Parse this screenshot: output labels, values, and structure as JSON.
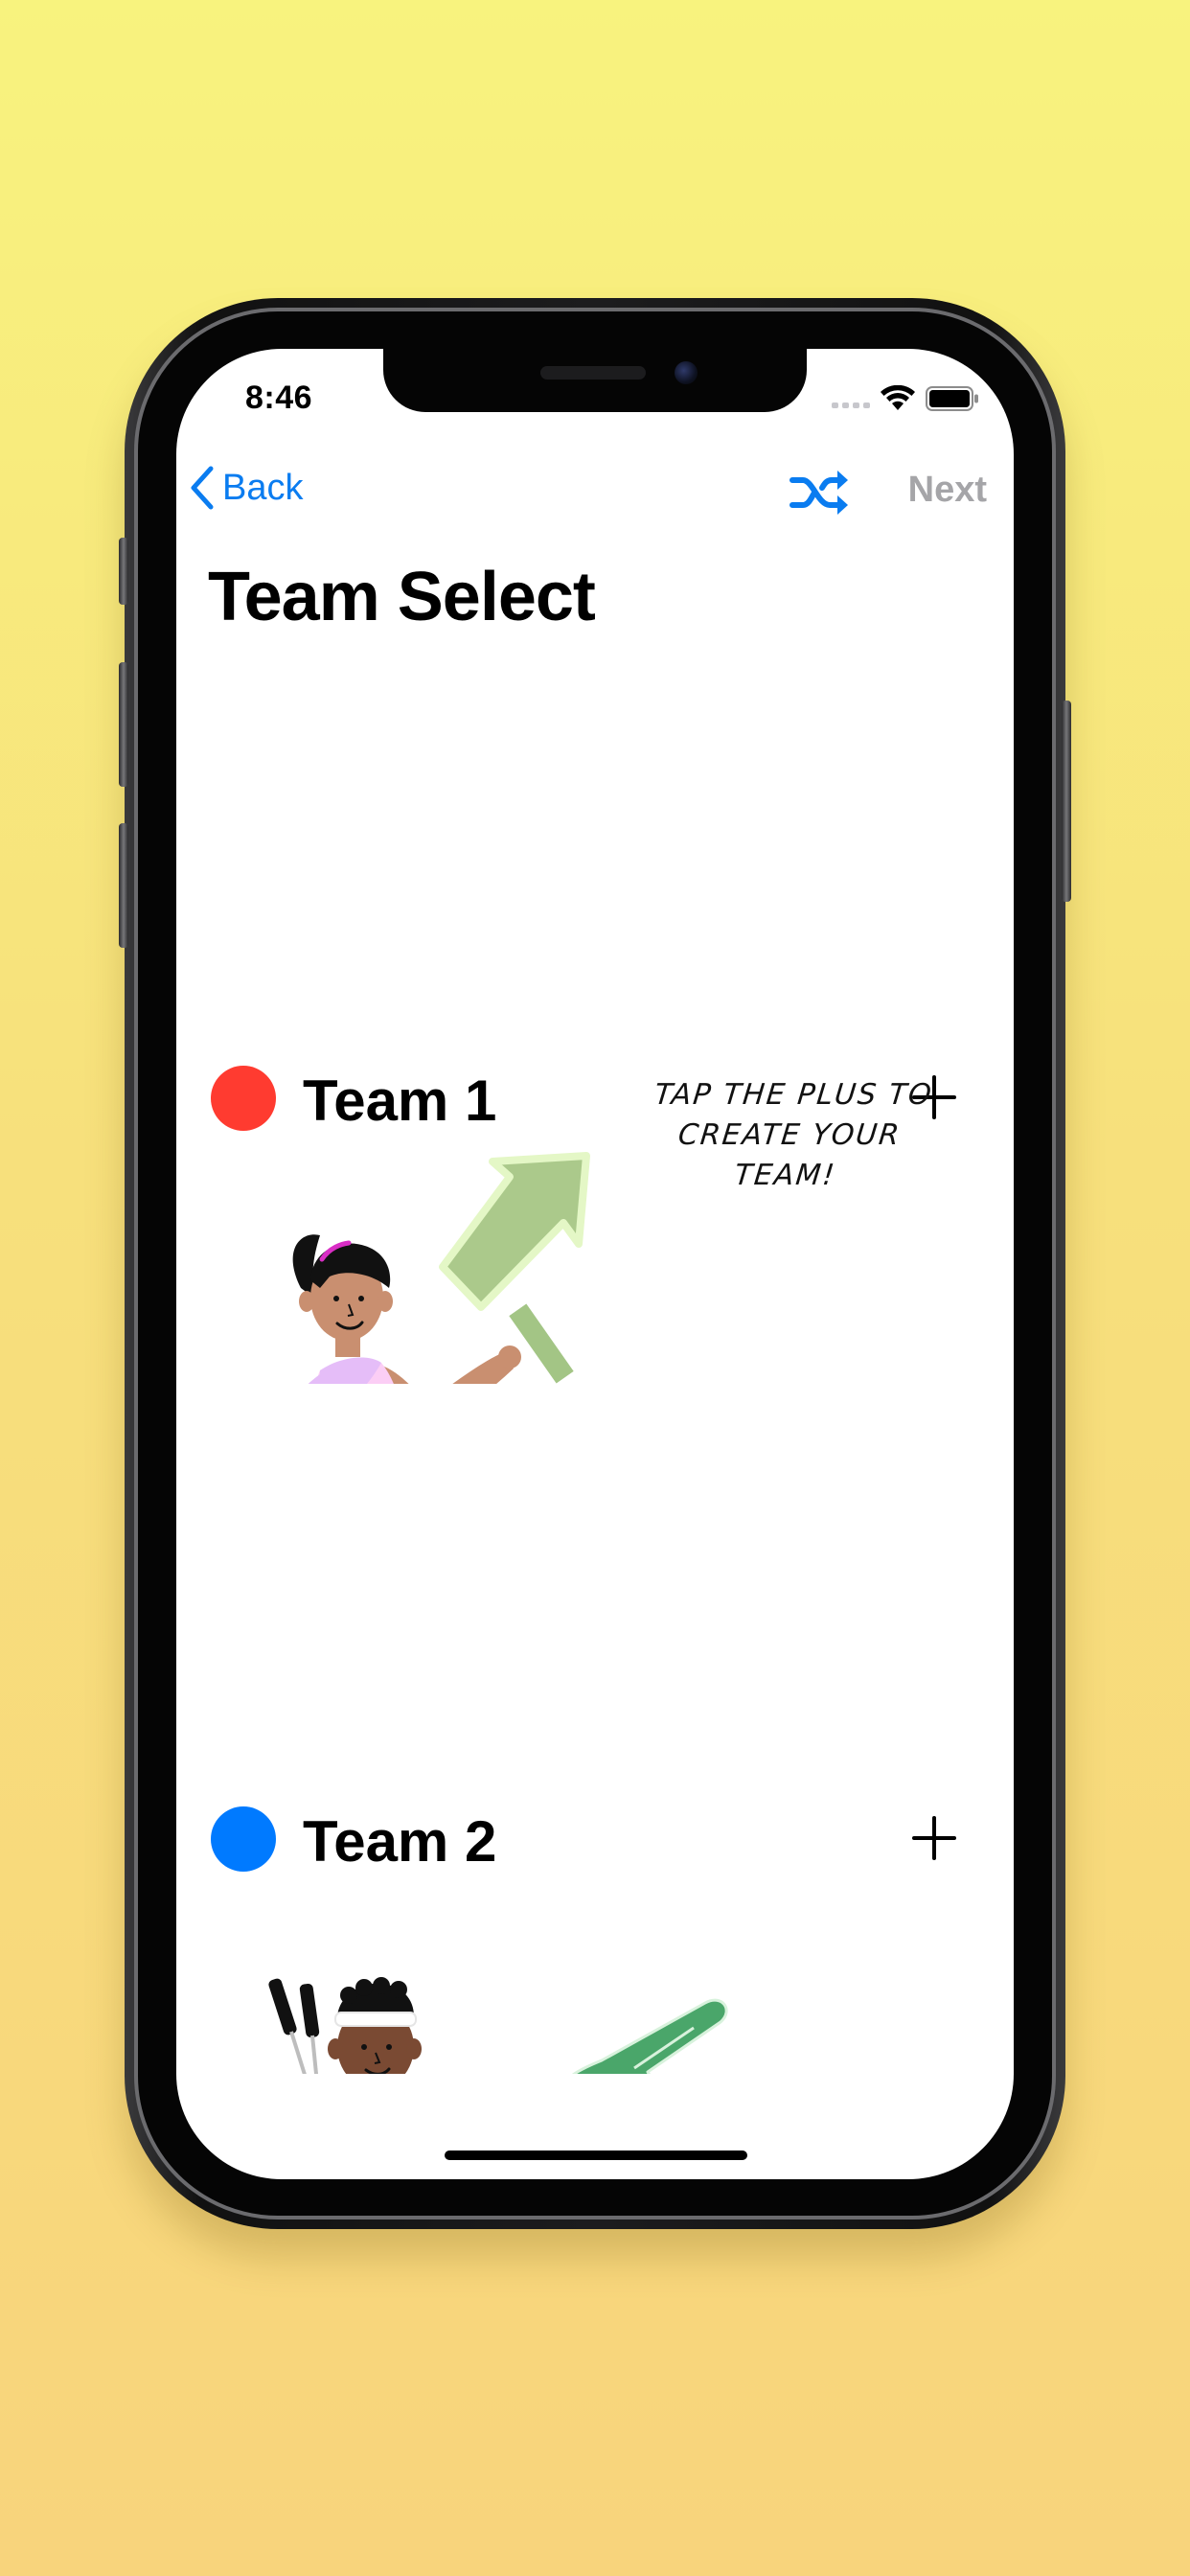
{
  "status_bar": {
    "time": "8:46"
  },
  "nav": {
    "back_label": "Back",
    "next_label": "Next",
    "shuffle_icon": "shuffle-icon",
    "back_icon": "chevron-left-icon",
    "accent_color": "#0a7cf0",
    "disabled_color": "#a5a5a8"
  },
  "page": {
    "title": "Team Select"
  },
  "teams": [
    {
      "name": "Team 1",
      "color": "#ff3b30",
      "add_icon": "plus-icon"
    },
    {
      "name": "Team 2",
      "color": "#007aff",
      "add_icon": "plus-icon"
    }
  ],
  "hint": {
    "line1": "TAP THE PLUS TO",
    "line2": "CREATE YOUR TEAM!"
  }
}
